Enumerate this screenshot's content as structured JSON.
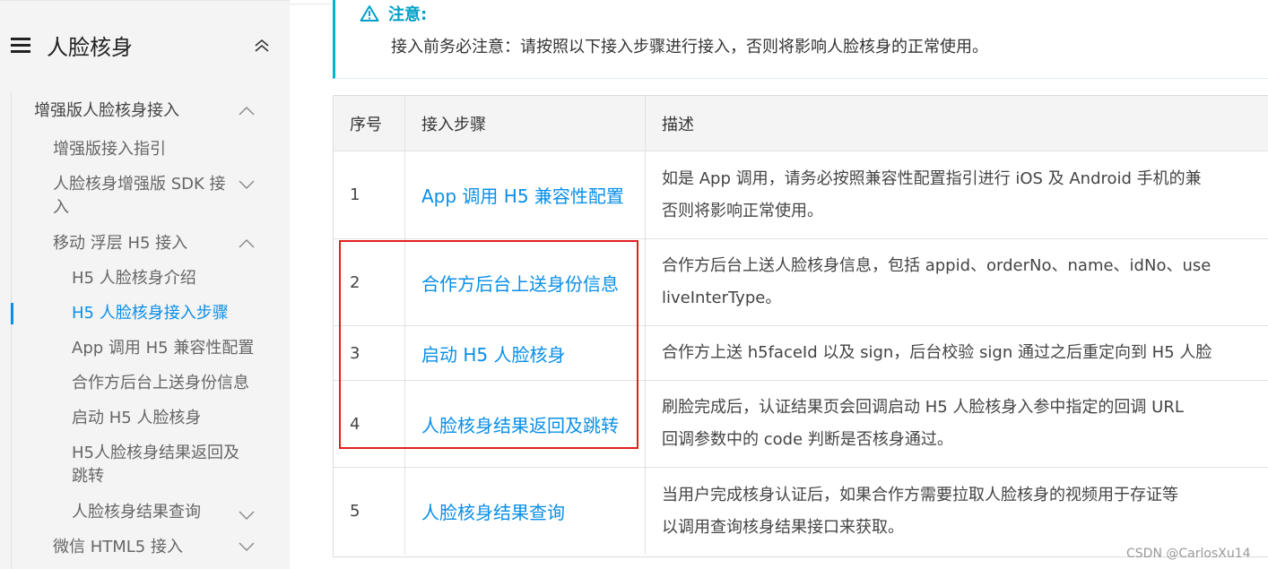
{
  "sidebar": {
    "title": "人脸核身",
    "items": [
      {
        "label": "增强版人脸核身接入"
      },
      {
        "label": "增强版接入指引"
      },
      {
        "label": "人脸核身增强版 SDK 接",
        "label2": "入"
      },
      {
        "label": "移动 浮层 H5 接入"
      },
      {
        "label": "H5 人脸核身介绍"
      },
      {
        "label": "H5 人脸核身接入步骤"
      },
      {
        "label": "App 调用 H5 兼容性配置"
      },
      {
        "label": "合作方后台上送身份信息"
      },
      {
        "label": "启动 H5 人脸核身"
      },
      {
        "label": "H5人脸核身结果返回及",
        "label2": "跳转"
      },
      {
        "label": "人脸核身结果查询"
      },
      {
        "label": "微信 HTML5 接入"
      }
    ]
  },
  "notice": {
    "title": "注意:",
    "text": "接入前务必注意：请按照以下接入步骤进行接入，否则将影响人脸核身的正常使用。"
  },
  "table": {
    "headers": [
      "序号",
      "接入步骤",
      "描述"
    ],
    "rows": [
      {
        "num": "1",
        "step": "App 调用 H5 兼容性配置",
        "desc1": "如是 App 调用，请务必按照兼容性配置指引进行 iOS 及 Android 手机的兼",
        "desc2": "否则将影响正常使用。"
      },
      {
        "num": "2",
        "step": "合作方后台上送身份信息",
        "desc1": "合作方后台上送人脸核身信息，包括 appid、orderNo、name、idNo、use",
        "desc2": "liveInterType。"
      },
      {
        "num": "3",
        "step": "启动 H5 人脸核身",
        "desc1": "合作方上送 h5faceId 以及 sign，后台校验 sign 通过之后重定向到 H5 人脸"
      },
      {
        "num": "4",
        "step": "人脸核身结果返回及跳转",
        "desc1": "刷脸完成后，认证结果页会回调启动 H5 人脸核身入参中指定的回调 URL",
        "desc2": "回调参数中的 code 判断是否核身通过。"
      },
      {
        "num": "5",
        "step": "人脸核身结果查询",
        "desc1": "当用户完成核身认证后，如果合作方需要拉取人脸核身的视频用于存证等",
        "desc2": "以调用查询核身结果接口来获取。"
      }
    ]
  },
  "watermark": "CSDN @CarlosXu14",
  "colors": {
    "accent": "#0a8fe8",
    "notice": "#00a0c6",
    "highlight": "#e1201e"
  }
}
